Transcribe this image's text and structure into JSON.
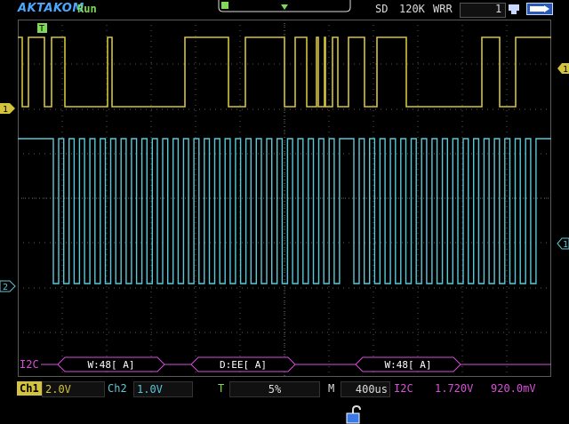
{
  "header": {
    "brand": "AKTAKOM",
    "run_state": "Run",
    "storage": "SD",
    "memory_depth": "120K",
    "acq_mode": "WRR",
    "trigger_count": "1",
    "icons": [
      "usb-icon",
      "battery-icon"
    ]
  },
  "markers": {
    "trigger_marker": "T",
    "ch1_marker": "1",
    "ch2_marker": "2",
    "ch1_level_marker": "1",
    "ch2_level_marker": "1"
  },
  "decode": {
    "bus_label": "I2C",
    "packets": [
      "W:48[ A]",
      "D:EE[ A]",
      "W:48[ A]"
    ]
  },
  "status": {
    "ch1_label": "Ch1",
    "ch1_scale": "2.0V",
    "ch2_label": "Ch2",
    "ch2_scale": "1.0V",
    "trigger_label": "T",
    "trigger_position": "5%",
    "timebase_label": "M",
    "timebase": "400us",
    "bus_label": "I2C",
    "ch1_threshold": "1.720V",
    "ch2_threshold": "920.0mV"
  },
  "colors": {
    "ch1": "#d4c43c",
    "ch2": "#5ac8d8",
    "decode": "#d84fd8",
    "trigger": "#7ed957",
    "grid": "#5a5a5a"
  }
}
